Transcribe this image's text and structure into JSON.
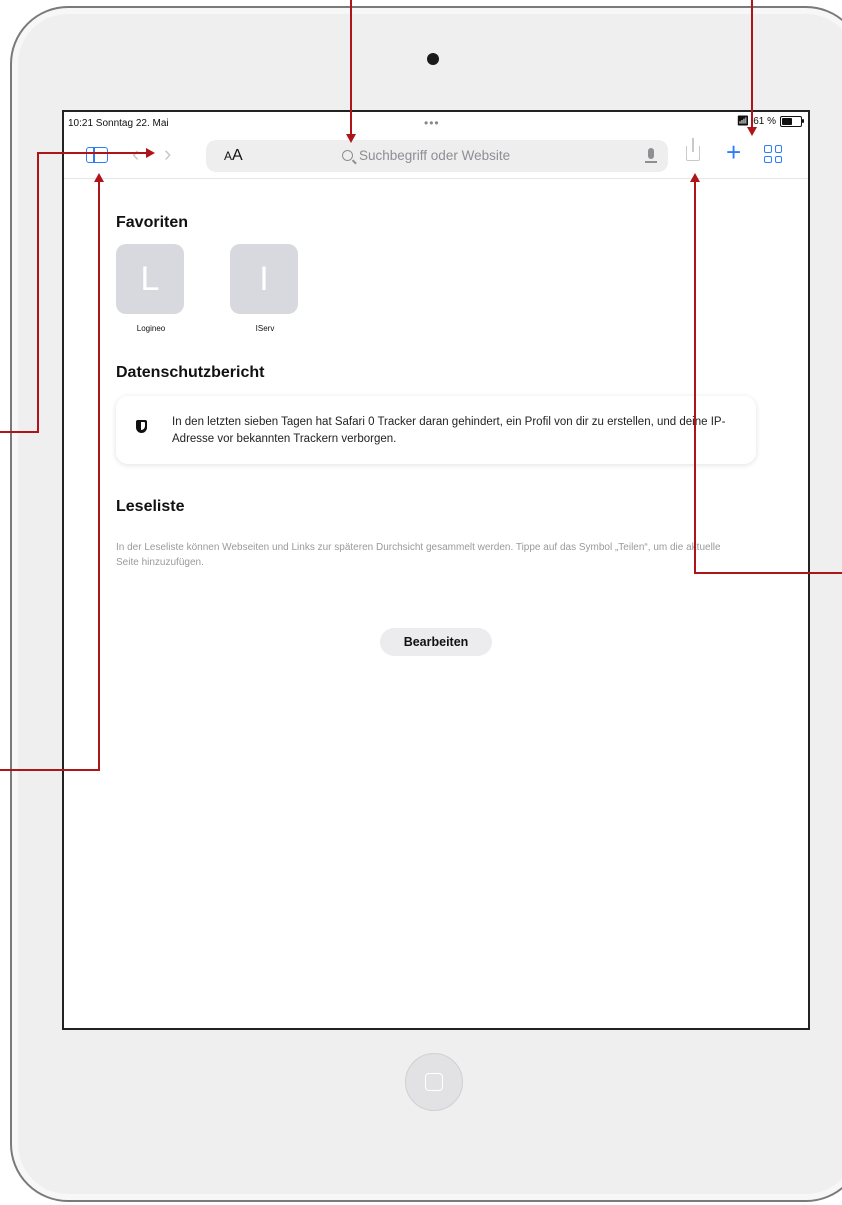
{
  "status_bar": {
    "time_date": "10:21  Sonntag 22. Mai",
    "dots": "•••",
    "battery_text": "61 %",
    "battery_level": 0.61
  },
  "toolbar": {
    "aa_label_small": "A",
    "aa_label_large": "A",
    "search_placeholder": "Suchbegriff oder Website",
    "back_icon": "chevron-left-icon",
    "forward_icon": "chevron-right-icon",
    "plus_label": "+"
  },
  "favorites": {
    "heading": "Favoriten",
    "items": [
      {
        "letter": "L",
        "label": "Logineo"
      },
      {
        "letter": "I",
        "label": "IServ"
      }
    ]
  },
  "privacy_report": {
    "heading": "Datenschutzbericht",
    "text": "In den letzten sieben Tagen hat Safari 0 Tracker daran gehindert, ein Profil von dir zu erstellen, und deine IP-Adresse vor bekannten Trackern verborgen."
  },
  "reading_list": {
    "heading": "Leseliste",
    "description": "In der Leseliste können Webseiten und Links zur späteren Durchsicht gesammelt werden. Tippe auf das Symbol „Teilen“, um die aktuelle Seite hinzuzufügen.",
    "edit_button": "Bearbeiten"
  },
  "colors": {
    "accent": "#2f7cf6",
    "annotation": "#b0141b"
  }
}
